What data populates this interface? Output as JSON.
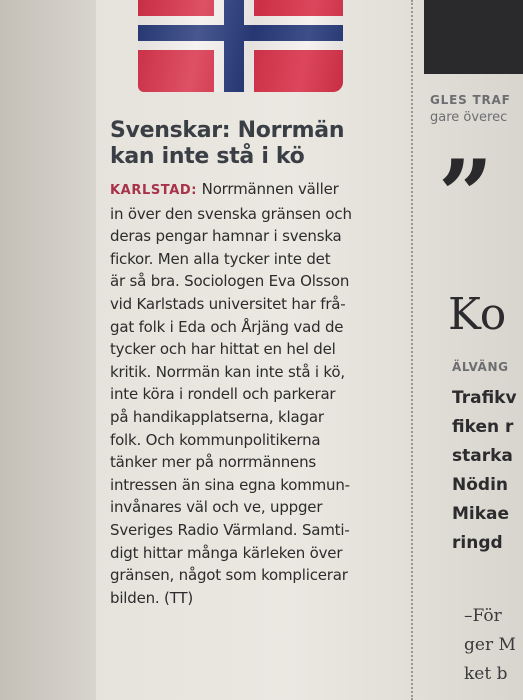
{
  "article": {
    "headline_lines": [
      "Svenskar: Norrmän",
      "kan inte stå i kö"
    ],
    "dateline": "KARLSTAD:",
    "first_line_rest": " Norrmännen väller",
    "body_lines": [
      "in över den svenska gränsen och",
      "deras pengar hamnar i svenska",
      "fickor. Men alla tycker inte det",
      "är så bra. Sociologen Eva Olsson",
      "vid Karlstads universitet har frå-",
      "gat folk i Eda och Årjäng vad de",
      "tycker och har hittat en hel del",
      "kritik. Norrmän kan inte stå i kö,",
      "inte köra i rondell och parkerar",
      "på handikapplatserna, klagar",
      "folk. Och kommunpolitikerna",
      "tänker mer på norrmännens",
      "intressen än sina egna kommun-",
      "invånares väl och ve, uppger",
      "Sveriges Radio Värmland. Samti-",
      "digt hittar många kärleken över",
      "gränsen, något som komplicerar",
      "bilden. (TT)"
    ]
  },
  "right_column": {
    "kicker": "GLES TRAF",
    "kicker_sub": "gare överec",
    "quote_mark": "”",
    "big_head": "Ko",
    "dateline": "ÄLVÄNG",
    "bold_lines": [
      "Trafikv",
      "fiken r",
      "starka",
      "Nödin",
      "Mikae",
      "ringd"
    ],
    "serif_lines": [
      "–För",
      "ger M",
      "ket b"
    ]
  },
  "colors": {
    "dateline_red": "#a8324a",
    "flag_red": "#d8324a",
    "flag_blue": "#283a7a"
  }
}
